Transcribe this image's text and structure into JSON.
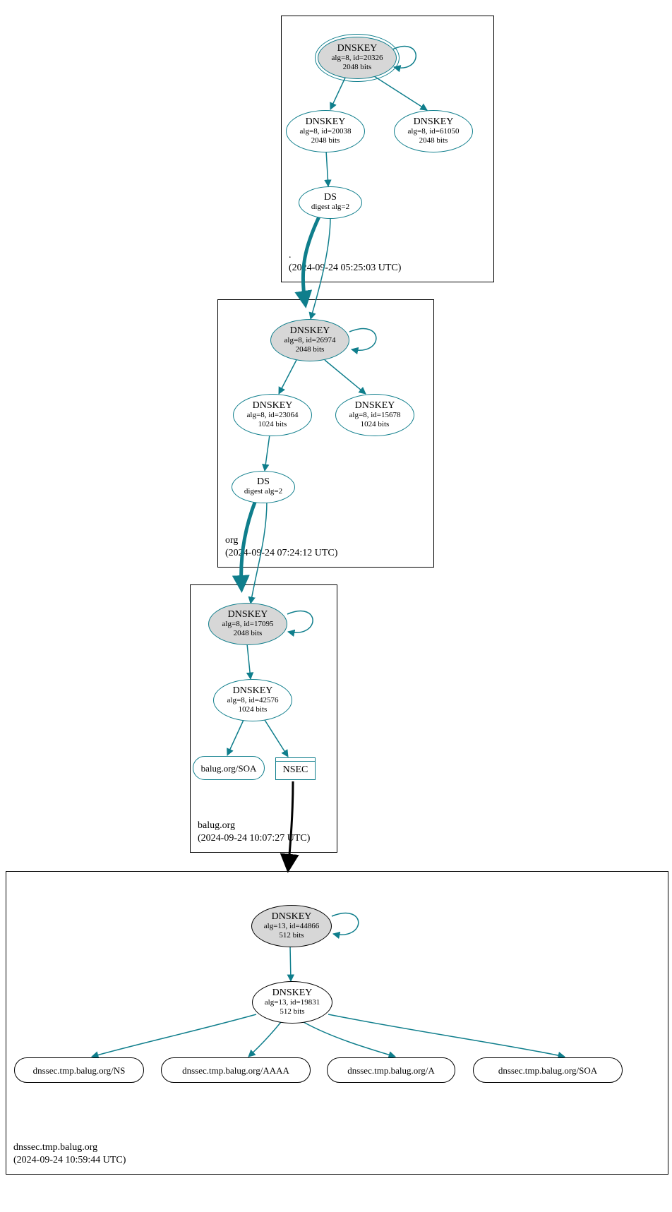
{
  "colors": {
    "teal": "#0f7e8c",
    "boxGray": "#000000",
    "nodeGray": "#d7d7d7"
  },
  "zones": [
    {
      "name": ".",
      "timestamp": "(2024-09-24 05:25:03 UTC)"
    },
    {
      "name": "org",
      "timestamp": "(2024-09-24 07:24:12 UTC)"
    },
    {
      "name": "balug.org",
      "timestamp": "(2024-09-24 10:07:27 UTC)"
    },
    {
      "name": "dnssec.tmp.balug.org",
      "timestamp": "(2024-09-24 10:59:44 UTC)"
    }
  ],
  "nodes": {
    "root_ksk": {
      "title": "DNSKEY",
      "line1": "alg=8, id=20326",
      "line2": "2048 bits"
    },
    "root_zsk1": {
      "title": "DNSKEY",
      "line1": "alg=8, id=20038",
      "line2": "2048 bits"
    },
    "root_zsk2": {
      "title": "DNSKEY",
      "line1": "alg=8, id=61050",
      "line2": "2048 bits"
    },
    "root_ds": {
      "title": "DS",
      "line1": "digest alg=2"
    },
    "org_ksk": {
      "title": "DNSKEY",
      "line1": "alg=8, id=26974",
      "line2": "2048 bits"
    },
    "org_zsk1": {
      "title": "DNSKEY",
      "line1": "alg=8, id=23064",
      "line2": "1024 bits"
    },
    "org_zsk2": {
      "title": "DNSKEY",
      "line1": "alg=8, id=15678",
      "line2": "1024 bits"
    },
    "org_ds": {
      "title": "DS",
      "line1": "digest alg=2"
    },
    "balug_ksk": {
      "title": "DNSKEY",
      "line1": "alg=8, id=17095",
      "line2": "2048 bits"
    },
    "balug_zsk": {
      "title": "DNSKEY",
      "line1": "alg=8, id=42576",
      "line2": "1024 bits"
    },
    "balug_soa": {
      "title": "balug.org/SOA"
    },
    "nsec": {
      "title": "NSEC"
    },
    "dtb_ksk": {
      "title": "DNSKEY",
      "line1": "alg=13, id=44866",
      "line2": "512 bits"
    },
    "dtb_zsk": {
      "title": "DNSKEY",
      "line1": "alg=13, id=19831",
      "line2": "512 bits"
    },
    "dtb_ns": {
      "title": "dnssec.tmp.balug.org/NS"
    },
    "dtb_aaaa": {
      "title": "dnssec.tmp.balug.org/AAAA"
    },
    "dtb_a": {
      "title": "dnssec.tmp.balug.org/A"
    },
    "dtb_soa": {
      "title": "dnssec.tmp.balug.org/SOA"
    }
  }
}
